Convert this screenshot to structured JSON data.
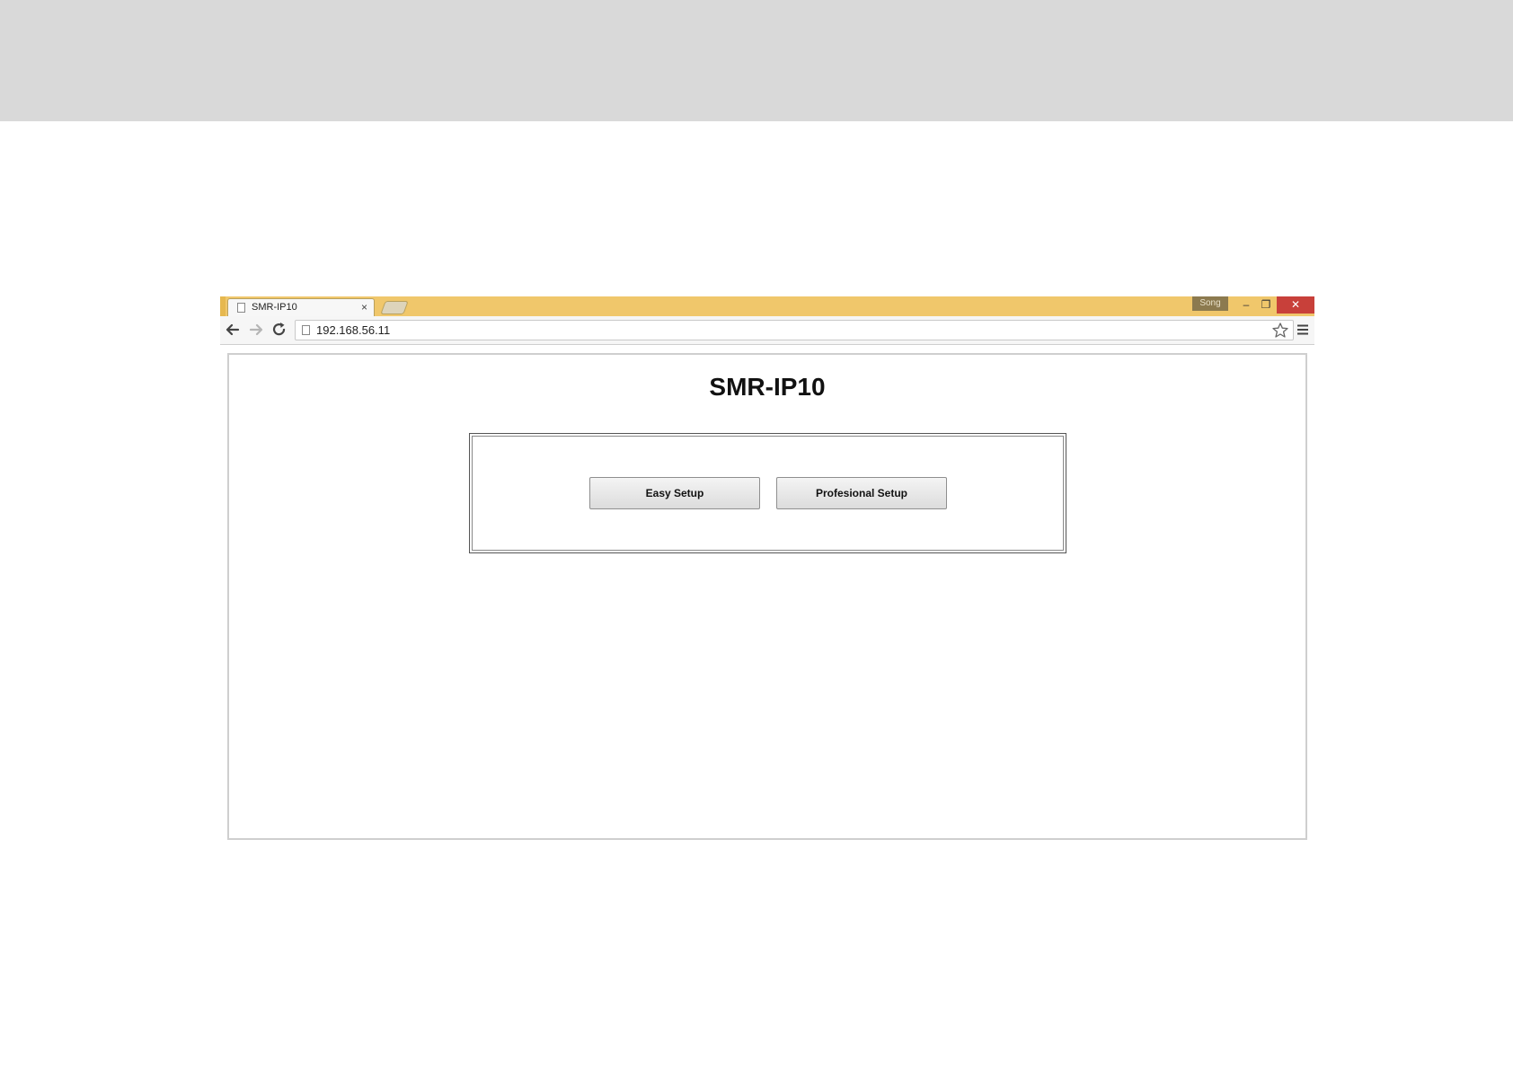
{
  "browser": {
    "tab_title": "SMR-IP10",
    "tab_close": "×",
    "user_badge": "Song",
    "url": "192.168.56.11",
    "window_controls": {
      "minimize": "–",
      "maximize": "❐",
      "close": "✕"
    }
  },
  "page": {
    "title": "SMR-IP10",
    "buttons": {
      "easy": "Easy Setup",
      "pro": "Profesional Setup"
    }
  },
  "colors": {
    "titlebar": "#f0c76b",
    "close": "#c8403a",
    "top_band": "#d9d9d9"
  }
}
